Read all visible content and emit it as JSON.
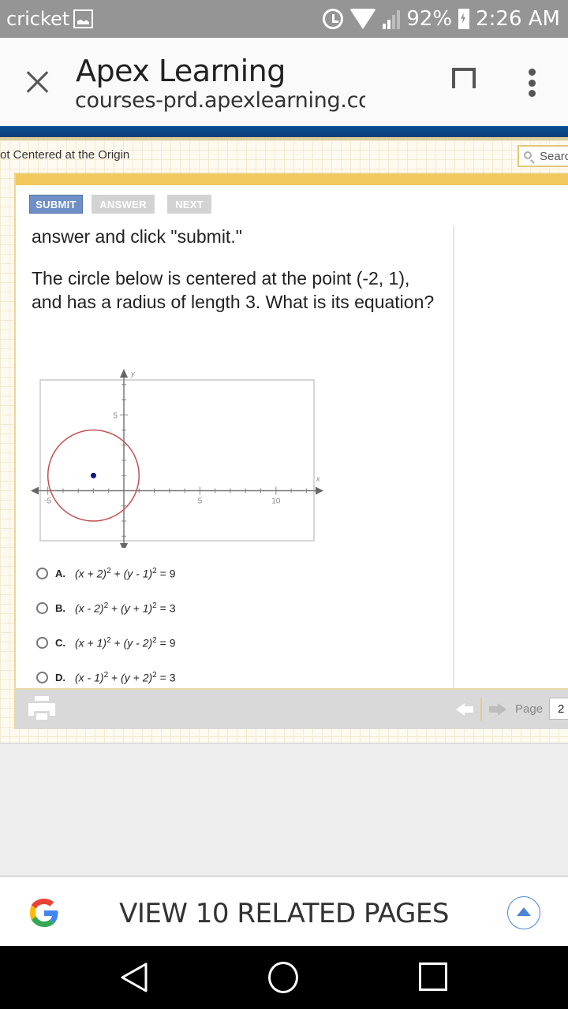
{
  "status_bar": {
    "carrier": "cricket",
    "battery": "92%",
    "time": "2:26 AM"
  },
  "browser": {
    "title": "Apex Learning",
    "url": "courses-prd.apexlearning.com"
  },
  "course": {
    "breadcrumb": "ot Centered at the Origin",
    "search_placeholder": "Search"
  },
  "toolbar": {
    "submit_label": "SUBMIT",
    "answer_label": "ANSWER",
    "next_label": "NEXT"
  },
  "question": {
    "instruction_tail": "answer and click \"submit.\"",
    "text": "The circle below is centered at the point (-2, 1), and has a radius of length 3. What is its equation?"
  },
  "graph": {
    "x_axis_label": "x",
    "y_axis_label": "y",
    "x_ticks_labeled": [
      "-5",
      "5",
      "10"
    ],
    "y_ticks_labeled": [
      "5"
    ],
    "x_range": [
      -5.5,
      12.5
    ],
    "y_range": [
      -3.3,
      7.3
    ],
    "circle": {
      "center": [
        -2,
        1
      ],
      "radius": 3,
      "color": "#c0504d"
    },
    "center_point_color": "#0a1a80"
  },
  "choices": [
    {
      "letter": "A.",
      "a": "(x + 2)",
      "b": "(y - 1)",
      "rhs": "= 9"
    },
    {
      "letter": "B.",
      "a": "(x - 2)",
      "b": "(y + 1)",
      "rhs": "= 3"
    },
    {
      "letter": "C.",
      "a": "(x + 1)",
      "b": "(y - 2)",
      "rhs": "= 9"
    },
    {
      "letter": "D.",
      "a": "(x - 1)",
      "b": "(y + 2)",
      "rhs": "= 3"
    }
  ],
  "pager": {
    "page_label": "Page",
    "page_value": "2"
  },
  "related": {
    "label": "VIEW 10 RELATED PAGES"
  }
}
